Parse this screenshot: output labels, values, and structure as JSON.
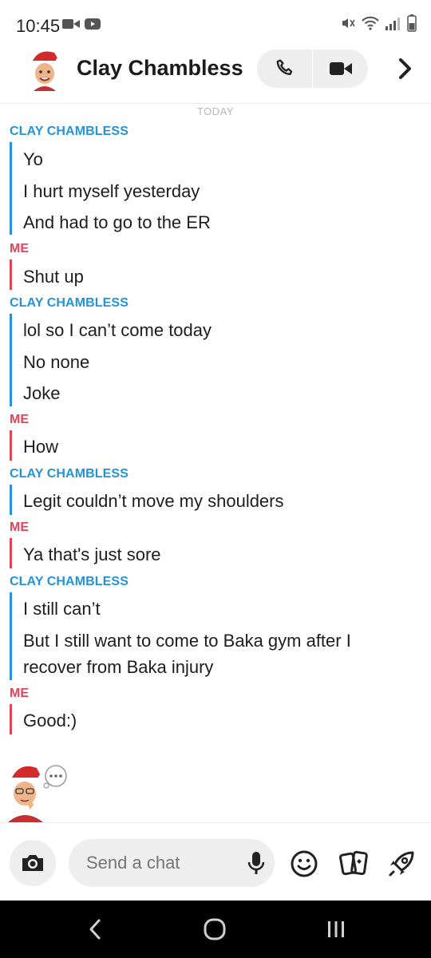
{
  "status_bar": {
    "time": "10:45",
    "left_icons": [
      "video-camera-icon",
      "youtube-icon"
    ],
    "right_icons": [
      "mute-icon",
      "wifi-icon",
      "signal-icon",
      "battery-icon"
    ]
  },
  "header": {
    "contact_name": "Clay Chambless",
    "avatar_icon": "bitmoji-avatar-icon",
    "call_icon": "phone-icon",
    "video_icon": "video-icon",
    "more_icon": "chevron-right-icon"
  },
  "chat": {
    "date_label": "TODAY",
    "groups": [
      {
        "sender": "CLAY CHAMBLESS",
        "messages": [
          "Yo",
          "I hurt myself yesterday",
          "And had to go to the ER"
        ]
      },
      {
        "sender": "ME",
        "messages": [
          "Shut up"
        ]
      },
      {
        "sender": "CLAY CHAMBLESS",
        "messages": [
          "lol so I can’t come today",
          "No none",
          "Joke"
        ]
      },
      {
        "sender": "ME",
        "messages": [
          "How"
        ]
      },
      {
        "sender": "CLAY CHAMBLESS",
        "messages": [
          "Legit couldn’t move my shoulders"
        ]
      },
      {
        "sender": "ME",
        "messages": [
          "Ya that's just sore"
        ]
      },
      {
        "sender": "CLAY CHAMBLESS",
        "messages": [
          "I still can’t",
          "But I still want to come to Baka gym after I",
          "recover from Baka injury"
        ]
      },
      {
        "sender": "ME",
        "messages": [
          "Good:)"
        ]
      }
    ],
    "typing_indicator_icon": "bitmoji-typing-icon"
  },
  "composer": {
    "placeholder": "Send a chat",
    "camera_icon": "camera-icon",
    "mic_icon": "microphone-icon",
    "emoji_icon": "smiley-icon",
    "stickers_icon": "cards-icon",
    "games_icon": "rocket-icon"
  },
  "navbar": {
    "back_icon": "back-icon",
    "home_icon": "home-icon",
    "recents_icon": "recents-icon"
  },
  "colors": {
    "friend": "#2594d6",
    "me": "#e04458",
    "text": "#1d1d1d"
  }
}
